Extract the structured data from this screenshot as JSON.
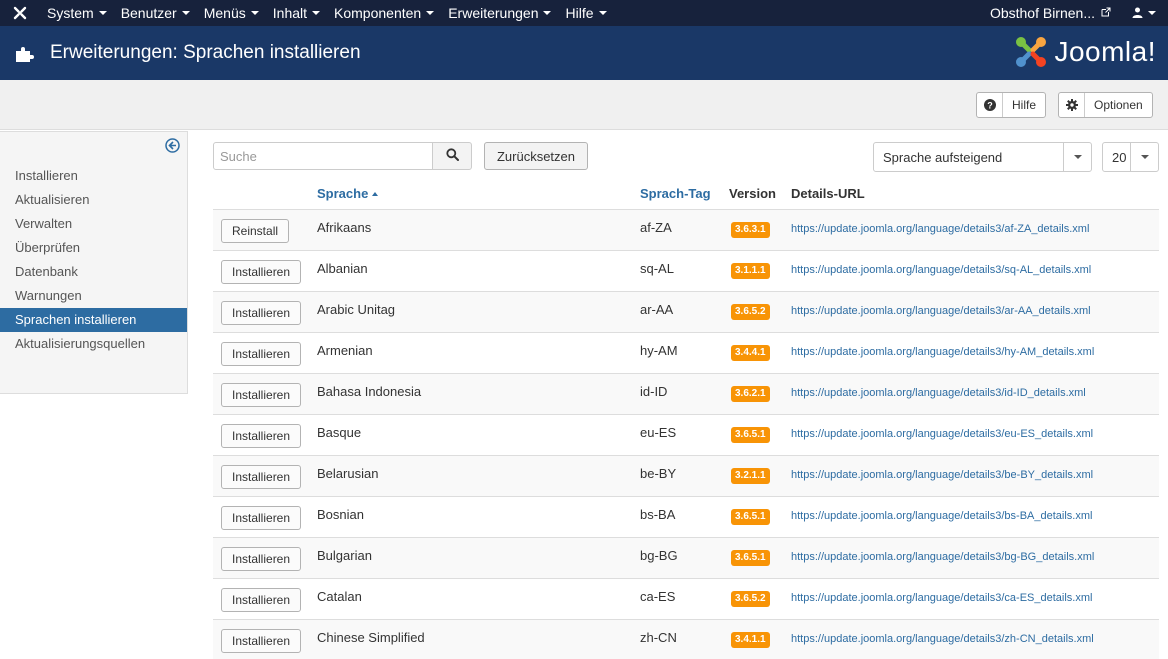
{
  "navbar": {
    "menus": [
      "System",
      "Benutzer",
      "Menüs",
      "Inhalt",
      "Komponenten",
      "Erweiterungen",
      "Hilfe"
    ],
    "site_name": "Obsthof Birnen..."
  },
  "header": {
    "title": "Erweiterungen: Sprachen installieren",
    "logo_text": "Joomla!"
  },
  "toolbar": {
    "help_label": "Hilfe",
    "options_label": "Optionen"
  },
  "sidebar": {
    "items": [
      {
        "label": "Installieren"
      },
      {
        "label": "Aktualisieren"
      },
      {
        "label": "Verwalten"
      },
      {
        "label": "Überprüfen"
      },
      {
        "label": "Datenbank"
      },
      {
        "label": "Warnungen"
      },
      {
        "label": "Sprachen installieren",
        "active": true
      },
      {
        "label": "Aktualisierungsquellen"
      }
    ]
  },
  "filters": {
    "search_placeholder": "Suche",
    "reset_label": "Zurücksetzen",
    "sort_value": "Sprache aufsteigend",
    "limit_value": "20"
  },
  "table": {
    "headers": {
      "language": "Sprache",
      "tag": "Sprach-Tag",
      "version": "Version",
      "url": "Details-URL"
    },
    "rows": [
      {
        "action": "Reinstall",
        "language": "Afrikaans",
        "tag": "af-ZA",
        "version": "3.6.3.1",
        "url": "https://update.joomla.org/language/details3/af-ZA_details.xml"
      },
      {
        "action": "Installieren",
        "language": "Albanian",
        "tag": "sq-AL",
        "version": "3.1.1.1",
        "url": "https://update.joomla.org/language/details3/sq-AL_details.xml"
      },
      {
        "action": "Installieren",
        "language": "Arabic Unitag",
        "tag": "ar-AA",
        "version": "3.6.5.2",
        "url": "https://update.joomla.org/language/details3/ar-AA_details.xml"
      },
      {
        "action": "Installieren",
        "language": "Armenian",
        "tag": "hy-AM",
        "version": "3.4.4.1",
        "url": "https://update.joomla.org/language/details3/hy-AM_details.xml"
      },
      {
        "action": "Installieren",
        "language": "Bahasa Indonesia",
        "tag": "id-ID",
        "version": "3.6.2.1",
        "url": "https://update.joomla.org/language/details3/id-ID_details.xml"
      },
      {
        "action": "Installieren",
        "language": "Basque",
        "tag": "eu-ES",
        "version": "3.6.5.1",
        "url": "https://update.joomla.org/language/details3/eu-ES_details.xml"
      },
      {
        "action": "Installieren",
        "language": "Belarusian",
        "tag": "be-BY",
        "version": "3.2.1.1",
        "url": "https://update.joomla.org/language/details3/be-BY_details.xml"
      },
      {
        "action": "Installieren",
        "language": "Bosnian",
        "tag": "bs-BA",
        "version": "3.6.5.1",
        "url": "https://update.joomla.org/language/details3/bs-BA_details.xml"
      },
      {
        "action": "Installieren",
        "language": "Bulgarian",
        "tag": "bg-BG",
        "version": "3.6.5.1",
        "url": "https://update.joomla.org/language/details3/bg-BG_details.xml"
      },
      {
        "action": "Installieren",
        "language": "Catalan",
        "tag": "ca-ES",
        "version": "3.6.5.2",
        "url": "https://update.joomla.org/language/details3/ca-ES_details.xml"
      },
      {
        "action": "Installieren",
        "language": "Chinese Simplified",
        "tag": "zh-CN",
        "version": "3.4.1.1",
        "url": "https://update.joomla.org/language/details3/zh-CN_details.xml"
      }
    ]
  },
  "colors": {
    "navbar": "#17223c",
    "header": "#1a3867",
    "link": "#2d6ca2",
    "badge": "#f89406",
    "sidebar_active": "#2d6ca2"
  },
  "icons": {
    "nav_logo": "joomla-icon",
    "header": "puzzle-icon",
    "help": "question-circle-icon",
    "options": "gear-icon",
    "search": "search-icon",
    "sidebar_toggle": "arrow-left-circle-icon",
    "external_link": "external-link-icon",
    "user": "user-icon"
  }
}
